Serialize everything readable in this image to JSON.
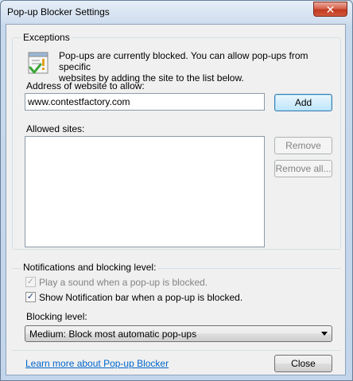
{
  "window": {
    "title": "Pop-up Blocker Settings",
    "close_symbol": "✕"
  },
  "exceptions": {
    "legend": "Exceptions",
    "icon": "popup-blocked-icon",
    "info_line1": "Pop-ups are currently blocked.  You can allow pop-ups from specific",
    "info_line2": "websites by adding the site to the list below.",
    "address_label": "Address of website to allow:",
    "address_value": "www.contestfactory.com",
    "add_label": "Add",
    "allowed_label": "Allowed sites:",
    "allowed_sites": [],
    "remove_label": "Remove",
    "remove_all_label": "Remove all..."
  },
  "notifications": {
    "legend": "Notifications and blocking level:",
    "play_sound_label": "Play a sound when a pop-up is blocked.",
    "play_sound_checked": true,
    "play_sound_enabled": false,
    "show_bar_label": "Show Notification bar when a pop-up is blocked.",
    "show_bar_checked": true,
    "blocking_level_label": "Blocking level:",
    "blocking_level_value": "Medium: Block most automatic pop-ups"
  },
  "footer": {
    "learn_more_label": "Learn more about Pop-up Blocker",
    "close_label": "Close"
  },
  "colors": {
    "link": "#0066cc",
    "close_button": "#c23a1f",
    "default_button_border": "#3c7fb1"
  }
}
